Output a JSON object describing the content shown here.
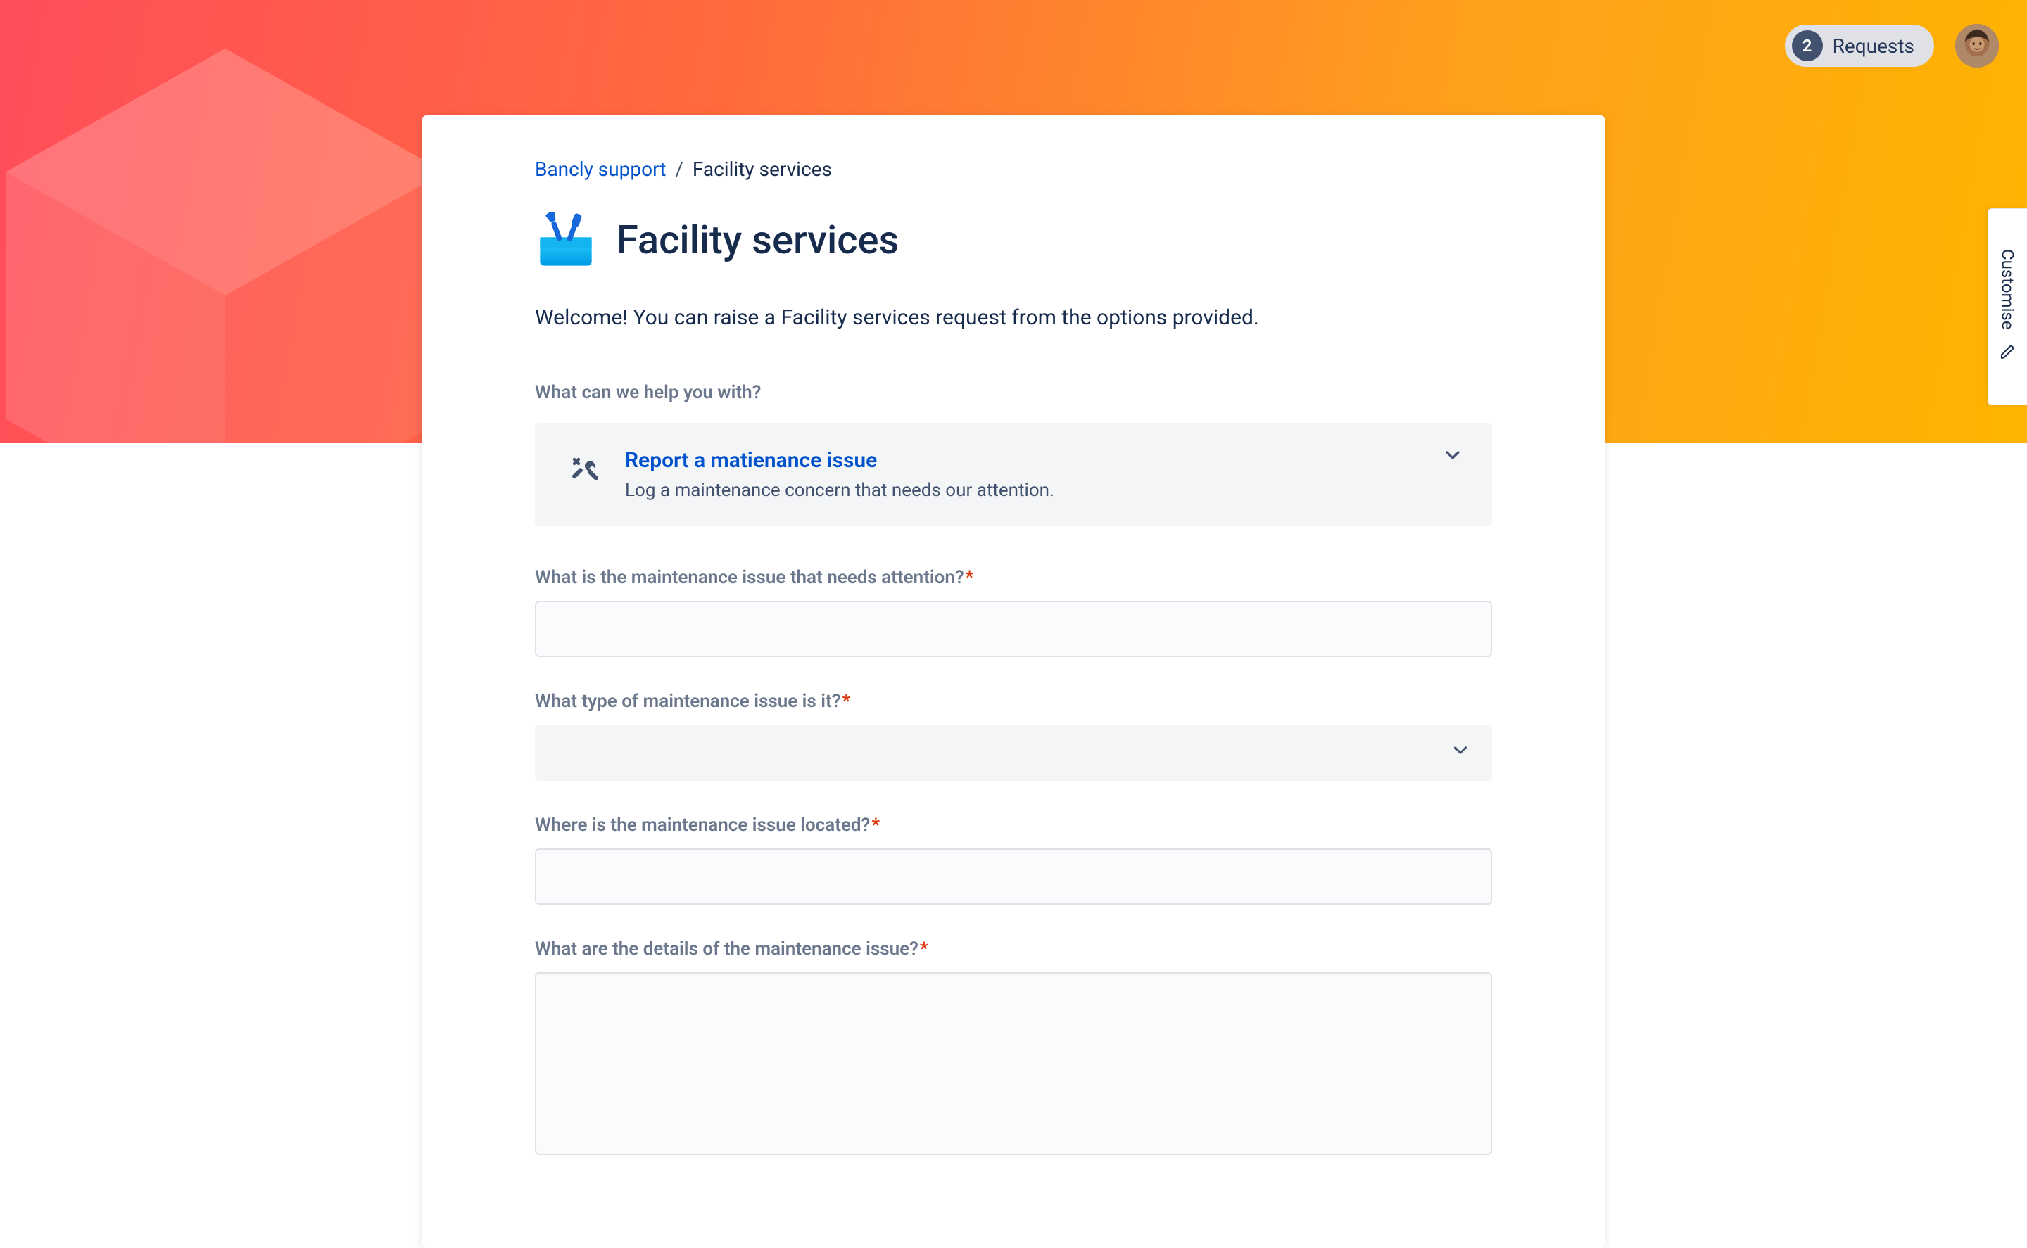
{
  "topbar": {
    "requests_count": "2",
    "requests_label": "Requests"
  },
  "side_tab": {
    "label": "Customise"
  },
  "breadcrumb": {
    "root": "Bancly support",
    "current": "Facility services"
  },
  "page": {
    "title": "Facility services",
    "welcome": "Welcome! You can raise a Facility services request from the options provided."
  },
  "help_section": {
    "label": "What can we help you with?"
  },
  "request_type": {
    "title": "Report a matienance issue",
    "desc": "Log a maintenance concern that needs our attention."
  },
  "fields": {
    "issue": {
      "label": "What is the maintenance issue that needs attention?"
    },
    "type": {
      "label": "What type of maintenance issue is it?"
    },
    "location": {
      "label": "Where is the maintenance issue located?"
    },
    "details": {
      "label": "What are the details of the maintenance issue?"
    }
  }
}
